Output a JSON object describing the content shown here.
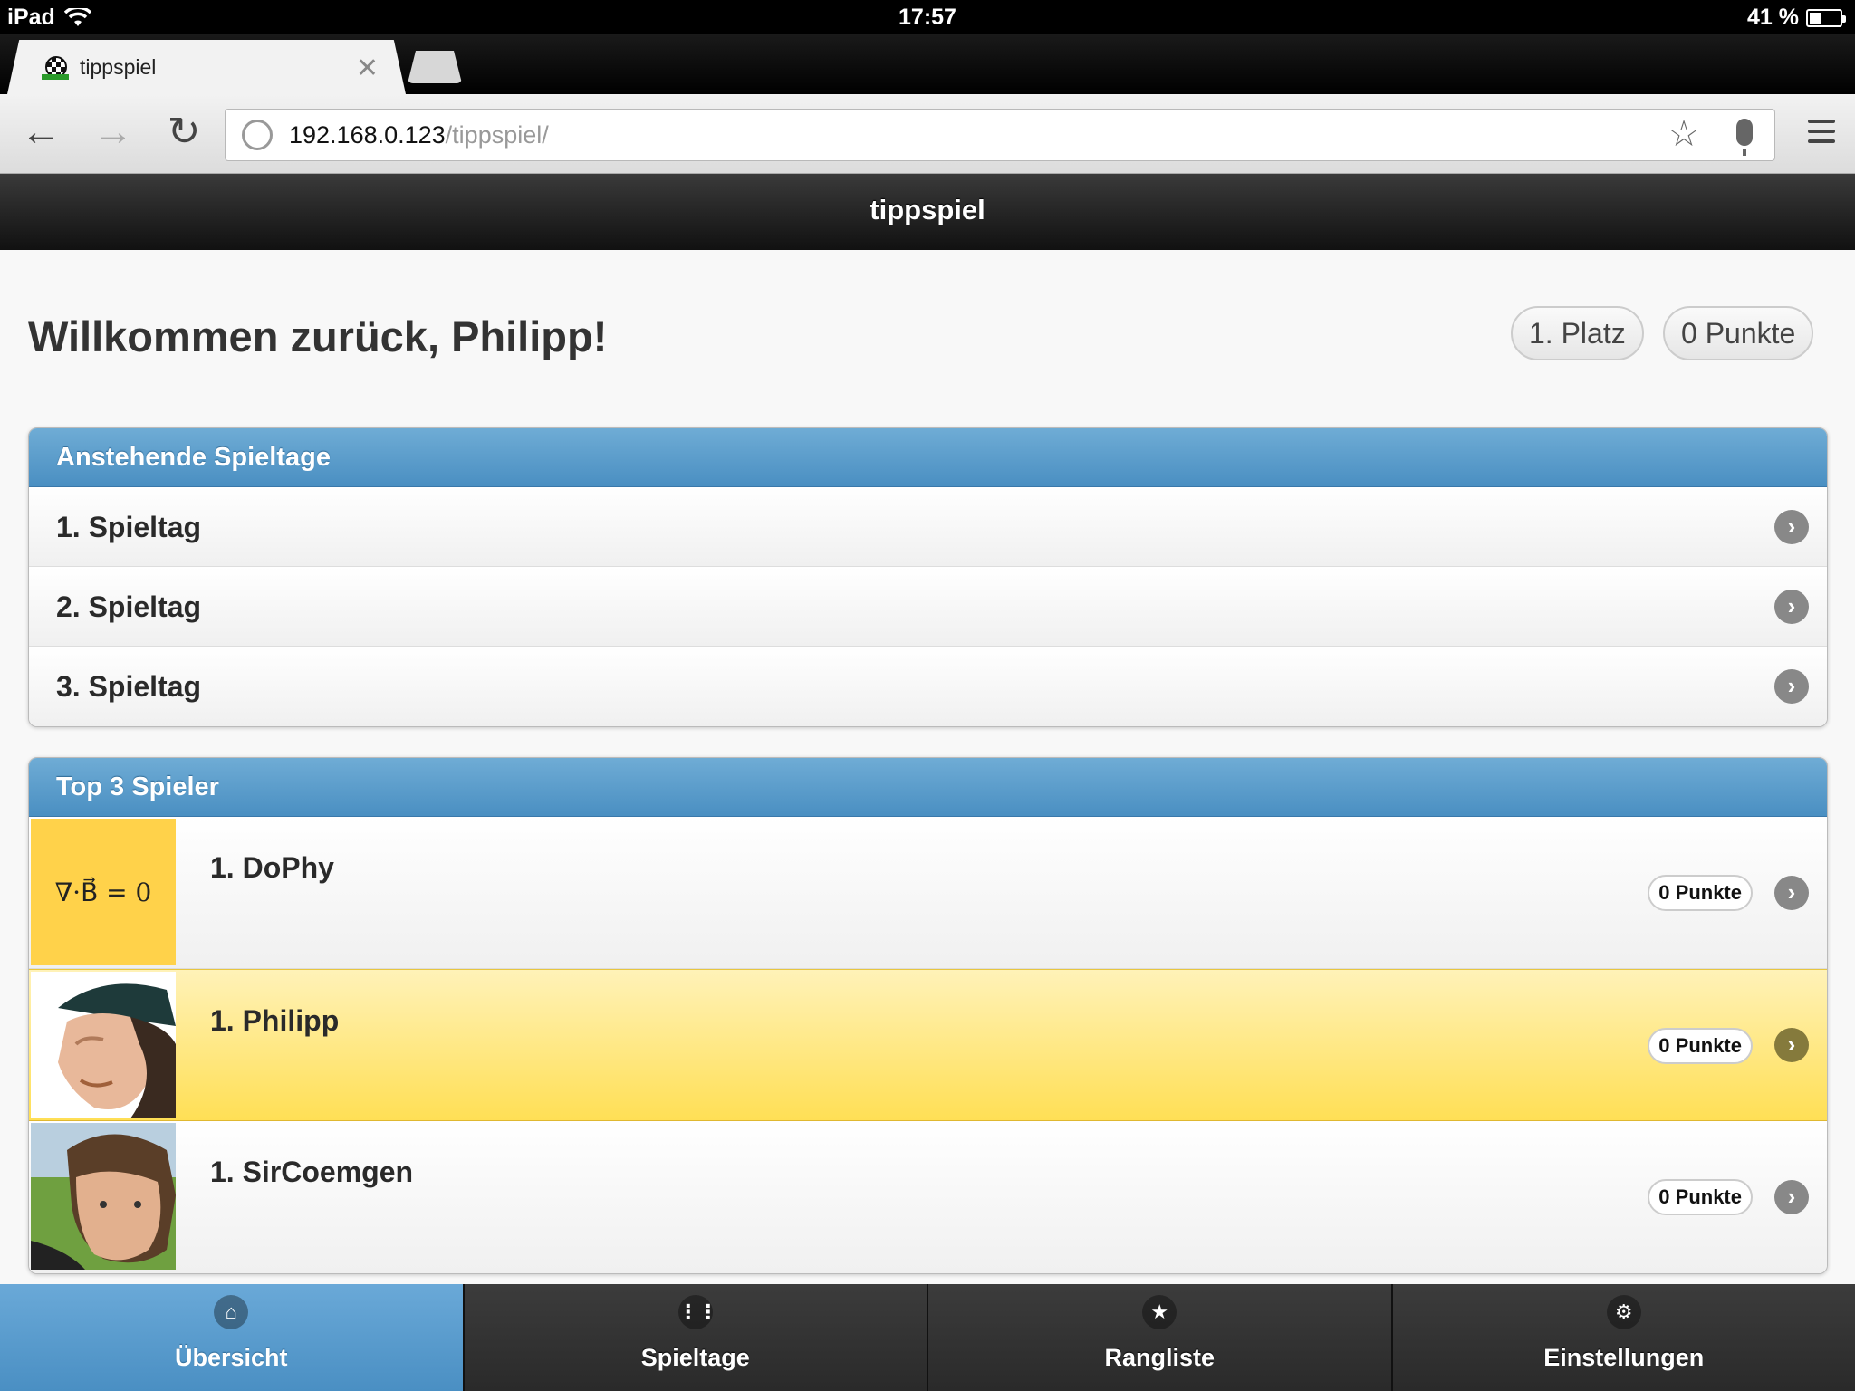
{
  "statusbar": {
    "device": "iPad",
    "time": "17:57",
    "battery": "41 %",
    "battery_level": 0.41
  },
  "browser": {
    "tab_title": "tippspiel",
    "url_host": "192.168.0.123",
    "url_path": "/tippspiel/"
  },
  "header": {
    "title": "tippspiel"
  },
  "welcome": {
    "text": "Willkommen zurück, Philipp!",
    "rank": "1. Platz",
    "points": "0 Punkte"
  },
  "upcoming": {
    "title": "Anstehende Spieltage",
    "items": [
      {
        "label": "1. Spieltag"
      },
      {
        "label": "2. Spieltag"
      },
      {
        "label": "3. Spieltag"
      }
    ]
  },
  "top": {
    "title": "Top 3 Spieler",
    "players": [
      {
        "name": "1. DoPhy",
        "points": "0 Punkte",
        "avatar_formula": "∇·B⃗ = 0"
      },
      {
        "name": "1. Philipp",
        "points": "0 Punkte"
      },
      {
        "name": "1. SirCoemgen",
        "points": "0 Punkte"
      }
    ]
  },
  "nav": {
    "items": [
      {
        "label": "Übersicht",
        "icon": "home-icon",
        "glyph": "⌂"
      },
      {
        "label": "Spieltage",
        "icon": "grid-icon",
        "glyph": "⋮⋮"
      },
      {
        "label": "Rangliste",
        "icon": "star-icon",
        "glyph": "★"
      },
      {
        "label": "Einstellungen",
        "icon": "gear-icon",
        "glyph": "⚙"
      }
    ]
  },
  "colors": {
    "accent": "#4a8fc3",
    "highlight": "#ffdf55"
  }
}
